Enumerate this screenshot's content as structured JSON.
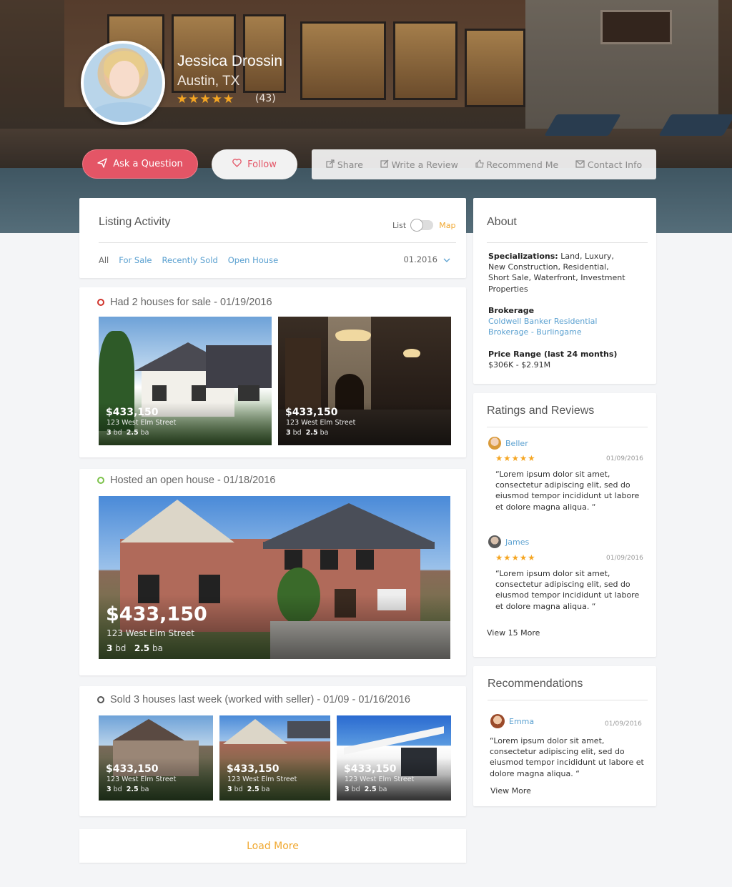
{
  "profile": {
    "name": "Jessica Drossin",
    "location": "Austin, TX",
    "stars": "★★★★★",
    "review_count": "(43)"
  },
  "actions": {
    "ask": "Ask a Question",
    "follow": "Follow",
    "share": "Share",
    "write_review": "Write a Review",
    "recommend": "Recommend Me",
    "contact": "Contact Info"
  },
  "listing_activity": {
    "title": "Listing Activity",
    "toggle_left": "List",
    "toggle_right": "Map",
    "filters": [
      "All",
      "For Sale",
      "Recently Sold",
      "Open House"
    ],
    "date": "01.2016"
  },
  "events": [
    {
      "heading": "Had 2 houses for sale - 01/19/2016",
      "dot_color": "#d0342c",
      "listings": [
        {
          "price": "$433,150",
          "address": "123 West Elm Street",
          "beds": "3",
          "baths": "2.5"
        },
        {
          "price": "$433,150",
          "address": "123 West Elm Street",
          "beds": "3",
          "baths": "2.5"
        }
      ]
    },
    {
      "heading": "Hosted an open house - 01/18/2016",
      "dot_color": "#7cc24a",
      "listings": [
        {
          "price": "$433,150",
          "address": "123 West Elm Street",
          "beds": "3",
          "baths": "2.5"
        }
      ]
    },
    {
      "heading": "Sold 3 houses last week  (worked with seller) - 01/09 - 01/16/2016",
      "dot_color": "#555555",
      "listings": [
        {
          "price": "$433,150",
          "address": "123 West Elm Street",
          "beds": "3",
          "baths": "2.5"
        },
        {
          "price": "$433,150",
          "address": "123 West Elm Street",
          "beds": "3",
          "baths": "2.5"
        },
        {
          "price": "$433,150",
          "address": "123 West Elm Street",
          "beds": "3",
          "baths": "2.5"
        }
      ]
    }
  ],
  "labels": {
    "bd": "bd",
    "ba": "ba"
  },
  "load_more": "Load More",
  "about": {
    "title": "About",
    "specializations_label": "Specializations:",
    "specializations": " Land, Luxury, New Construction, Residential, Short Sale, Waterfront, Investment Properties",
    "brokerage_label": "Brokerage",
    "brokerage": "Coldwell Banker Residential Brokerage - Burlingame",
    "price_range_label": "Price Range (last 24 months)",
    "price_range": "$306K - $2.91M"
  },
  "ratings": {
    "title": "Ratings and Reviews",
    "reviews": [
      {
        "name": "Beller",
        "stars": "★★★★★",
        "date": "01/09/2016",
        "text": "“Lorem ipsum dolor sit amet, consectetur adipiscing elit, sed do eiusmod tempor incididunt ut labore et dolore magna aliqua. “"
      },
      {
        "name": "James",
        "stars": "★★★★★",
        "date": "01/09/2016",
        "text": "“Lorem ipsum dolor sit amet, consectetur adipiscing elit, sed do eiusmod tempor incididunt ut labore et dolore magna aliqua. “"
      }
    ],
    "view_more": "View 15 More"
  },
  "recommendations": {
    "title": "Recommendations",
    "name": "Emma",
    "date": "01/09/2016",
    "text": "“Lorem ipsum dolor sit amet, consectetur adipiscing elit, sed do eiusmod tempor incididunt ut labore et dolore magna aliqua. “",
    "view_more": "View More"
  },
  "colors": {
    "accent_red": "#e45566",
    "link_blue": "#5aa0d0",
    "star_orange": "#f5a623",
    "load_more_orange": "#f0a830"
  }
}
